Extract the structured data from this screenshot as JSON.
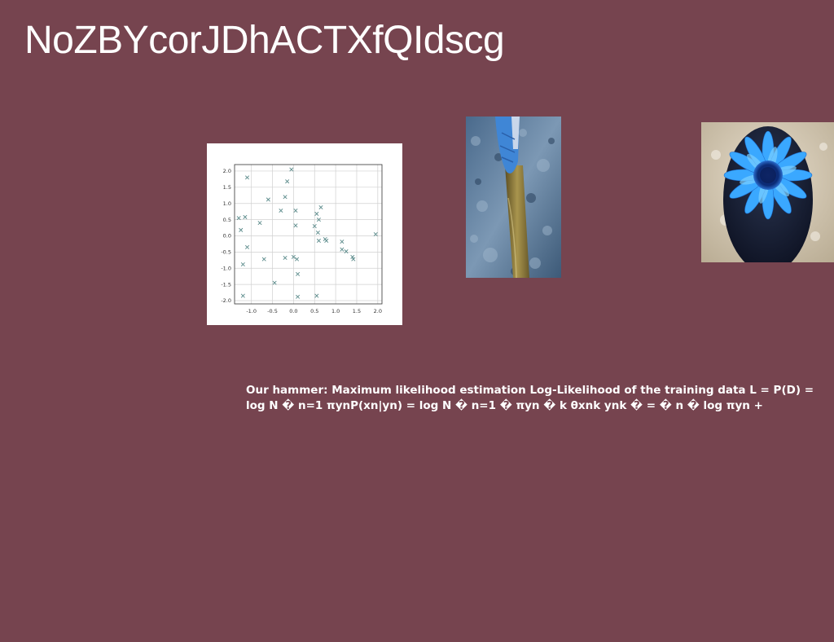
{
  "slide": {
    "title": "NoZBYcorJDhACTXfQIdscg",
    "caption": "Our hammer: Maximum likelihood estimation Log-Likelihood of the training data L = P(D) = log N � n=1 πynP(xn|yn) = log N � n=1 � πyn � k θxnk ynk � = � n � log πyn +"
  },
  "images": {
    "bat_photo_icon": "baseball-bat-photo",
    "flower_photo_icon": "blue-sunflower-photo"
  },
  "chart_data": {
    "type": "scatter",
    "title": "",
    "xlabel": "",
    "ylabel": "",
    "xlim": [
      -1.4,
      2.1
    ],
    "ylim": [
      -2.1,
      2.2
    ],
    "xticks": [
      "-1.0",
      "-0.5",
      "0.0",
      "0.5",
      "1.0",
      "1.5",
      "2.0"
    ],
    "yticks": [
      "2.0",
      "1.5",
      "1.0",
      "0.5",
      "0.0",
      "-0.5",
      "-1.0",
      "-1.5",
      "-2.0"
    ],
    "grid": true,
    "marker": "x",
    "marker_color": "#5a8a8a",
    "points": [
      [
        -1.3,
        0.55
      ],
      [
        -1.25,
        0.18
      ],
      [
        -1.2,
        -0.88
      ],
      [
        -1.15,
        0.58
      ],
      [
        -1.1,
        1.8
      ],
      [
        -1.1,
        -0.35
      ],
      [
        -0.8,
        0.4
      ],
      [
        -0.7,
        -0.72
      ],
      [
        -0.6,
        1.12
      ],
      [
        -0.45,
        -1.45
      ],
      [
        -0.3,
        0.78
      ],
      [
        -0.2,
        1.2
      ],
      [
        -0.2,
        -0.68
      ],
      [
        -0.15,
        1.68
      ],
      [
        -0.05,
        2.05
      ],
      [
        0.0,
        -0.65
      ],
      [
        0.05,
        0.78
      ],
      [
        0.05,
        0.32
      ],
      [
        0.08,
        -0.72
      ],
      [
        0.1,
        -1.18
      ],
      [
        0.1,
        -1.88
      ],
      [
        0.5,
        0.3
      ],
      [
        0.55,
        0.68
      ],
      [
        0.58,
        0.1
      ],
      [
        0.6,
        -0.15
      ],
      [
        0.6,
        0.5
      ],
      [
        0.65,
        0.88
      ],
      [
        0.55,
        -1.85
      ],
      [
        0.75,
        -0.1
      ],
      [
        0.78,
        -0.15
      ],
      [
        1.15,
        -0.18
      ],
      [
        1.15,
        -0.42
      ],
      [
        1.25,
        -0.48
      ],
      [
        1.4,
        -0.65
      ],
      [
        1.42,
        -0.72
      ],
      [
        1.95,
        0.05
      ],
      [
        -1.2,
        -1.85
      ]
    ]
  }
}
